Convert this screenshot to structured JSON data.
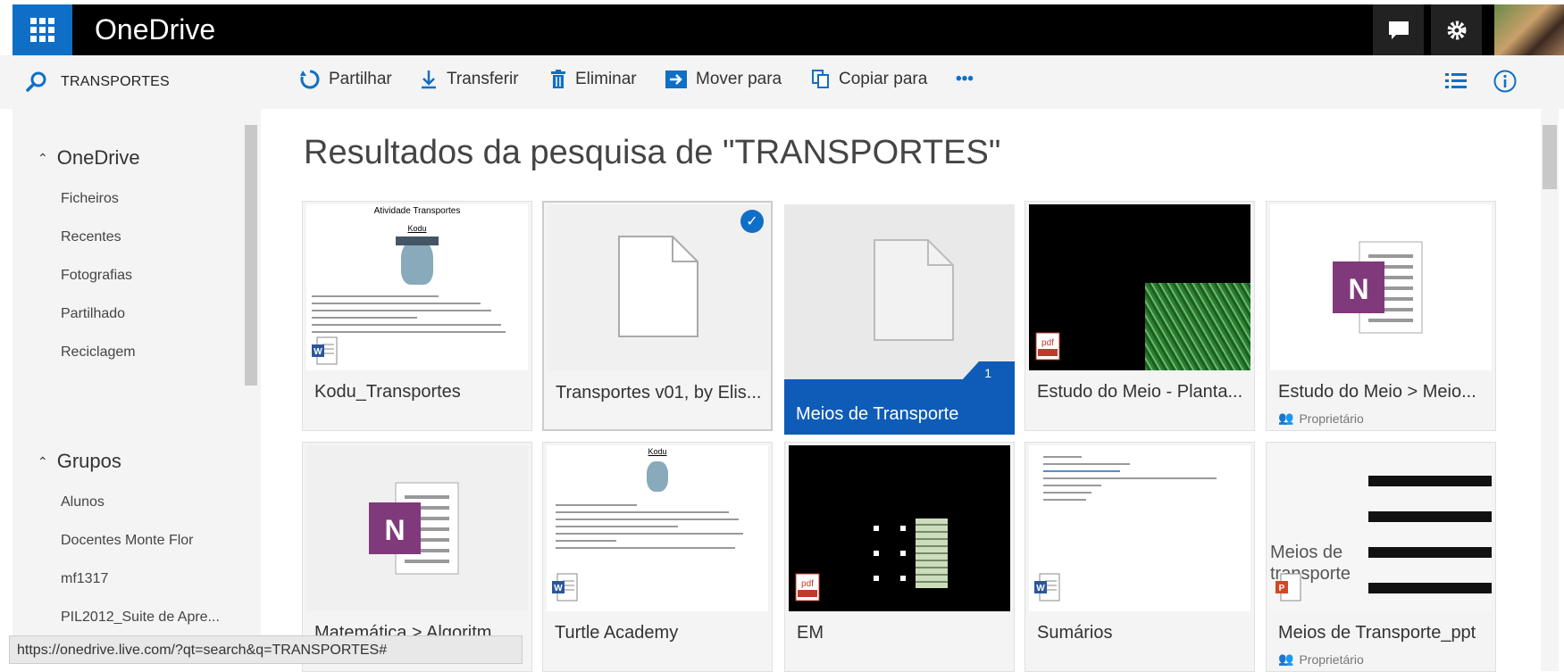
{
  "app": {
    "brand": "OneDrive"
  },
  "search": {
    "query": "TRANSPORTES"
  },
  "commands": [
    {
      "label": "Partilhar",
      "icon": "share-icon"
    },
    {
      "label": "Transferir",
      "icon": "download-icon"
    },
    {
      "label": "Eliminar",
      "icon": "trash-icon"
    },
    {
      "label": "Mover para",
      "icon": "move-icon"
    },
    {
      "label": "Copiar para",
      "icon": "copy-icon"
    },
    {
      "label": "•••",
      "icon": "more-icon"
    }
  ],
  "sidebar": {
    "onedrive": {
      "title": "OneDrive",
      "items": [
        "Ficheiros",
        "Recentes",
        "Fotografias",
        "Partilhado",
        "Reciclagem"
      ]
    },
    "groups": {
      "title": "Grupos",
      "items": [
        "Alunos",
        "Docentes Monte Flor",
        "mf1317",
        "PIL2012_Suite de Apre..."
      ]
    }
  },
  "main": {
    "title": "Resultados da pesquisa de \"TRANSPORTES\""
  },
  "tiles": [
    {
      "name": "Kodu_Transportes",
      "doc_title": "Atividade Transportes",
      "doc_sub": "Kodu"
    },
    {
      "name": "Transportes v01, by Elis..."
    },
    {
      "name": "Meios de Transporte",
      "count": "1"
    },
    {
      "name": "Estudo do Meio - Planta..."
    },
    {
      "name": "Estudo do Meio > Meio...",
      "owner": "Proprietário"
    },
    {
      "name": "Matemática > Algoritm..."
    },
    {
      "name": "Turtle Academy",
      "doc_sub": "Kodu"
    },
    {
      "name": "EM"
    },
    {
      "name": "Sumários"
    },
    {
      "name": "Meios de Transporte_ppt",
      "owner": "Proprietário",
      "thumb_text": "Meios de\ntransporte"
    }
  ],
  "status": {
    "url": "https://onedrive.live.com/?qt=search&q=TRANSPORTES#"
  },
  "colors": {
    "accent": "#0f6fc6",
    "onenote": "#80397b",
    "word": "#2b579a",
    "pdf": "#c0392b",
    "ppt": "#d24726"
  }
}
